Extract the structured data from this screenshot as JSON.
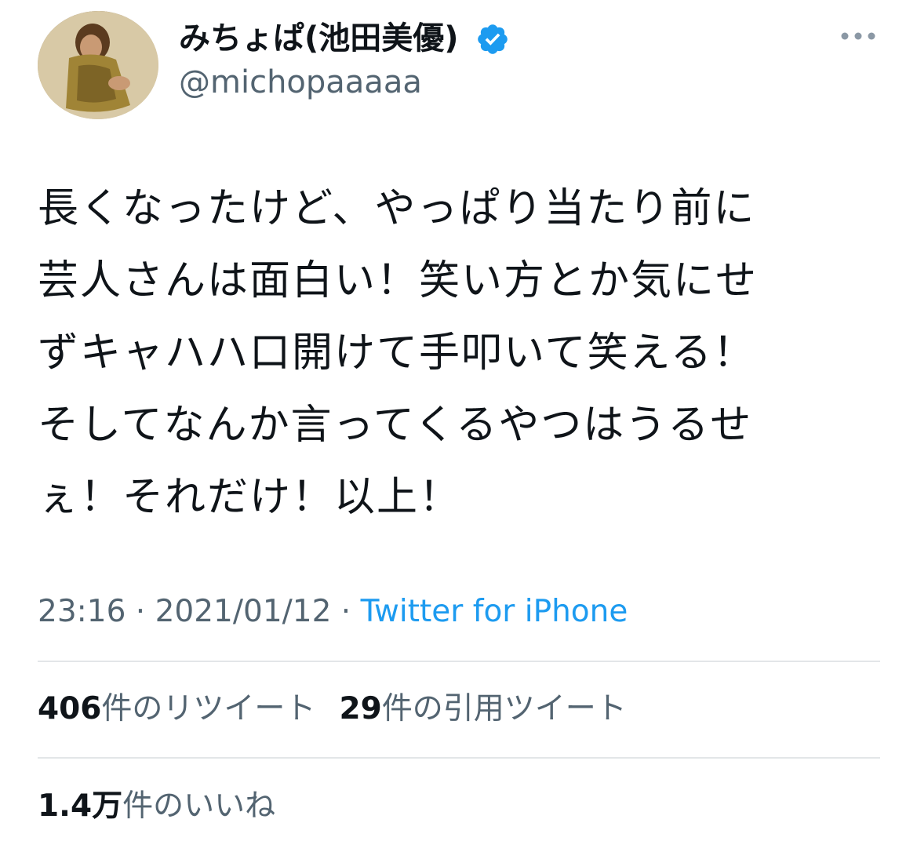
{
  "tweet": {
    "display_name": "みちょぱ(池田美優)",
    "handle": "@michopaaaaa",
    "verified_icon": "verified-badge-icon",
    "more_icon": "more-horizontal-icon",
    "text_lines": [
      "長くなったけど、やっぱり当たり前に",
      "芸人さんは面白い！笑い方とか気にせ",
      "ずキャハハ口開けて手叩いて笑える！",
      "そしてなんか言ってくるやつはうるせ",
      "ぇ！それだけ！以上！"
    ],
    "time": "23:16",
    "separator": " · ",
    "date": "2021/01/12",
    "source": "Twitter for iPhone"
  },
  "stats": {
    "retweets_count": "406",
    "retweets_label": "件のリツイート",
    "quotes_count": "29",
    "quotes_label": "件の引用ツイート",
    "likes_count": "1.4万",
    "likes_label": "件のいいね"
  },
  "colors": {
    "text_primary": "#0f1419",
    "text_secondary": "#536471",
    "link": "#1d9bf0",
    "verified": "#1d9bf0",
    "divider": "#e3e6e8"
  }
}
